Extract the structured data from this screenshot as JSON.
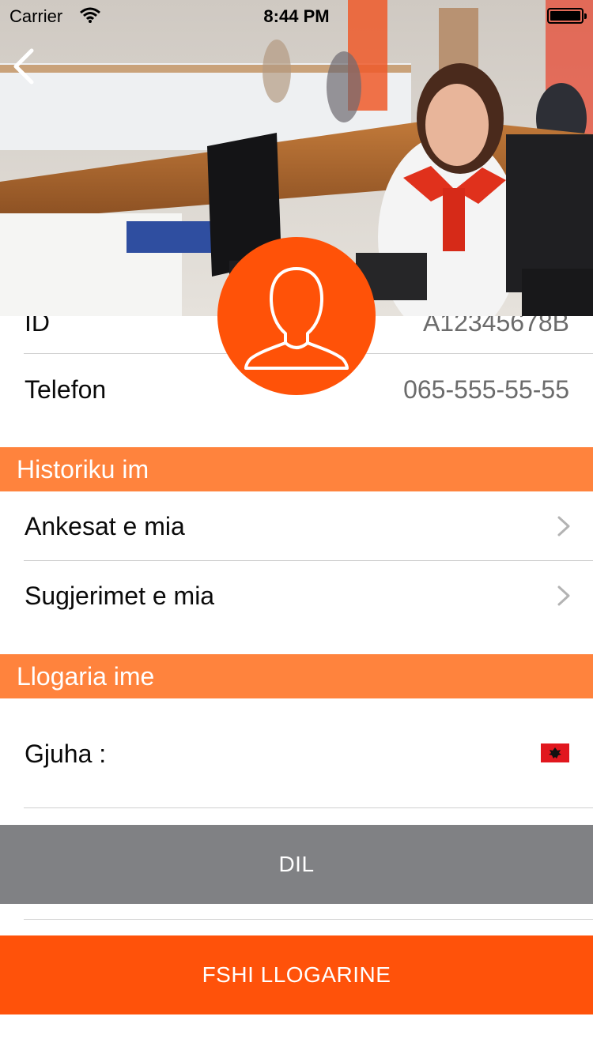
{
  "status_bar": {
    "carrier": "Carrier",
    "time": "8:44 PM"
  },
  "profile": {
    "rows": [
      {
        "label": "ID",
        "value": "A12345678B"
      },
      {
        "label": "Telefon",
        "value": "065-555-55-55"
      }
    ]
  },
  "history": {
    "title": "Historiku im",
    "items": [
      {
        "label": "Ankesat e mia"
      },
      {
        "label": "Sugjerimet e mia"
      }
    ]
  },
  "account": {
    "title": "Llogaria ime",
    "language_label": "Gjuha :",
    "language_flag": "albania-flag-icon"
  },
  "buttons": {
    "logout": "DIL",
    "delete_account": "FSHI LLOGARINE"
  },
  "colors": {
    "accent_orange": "#ff5208",
    "section_orange": "#ff833d",
    "logout_gray": "#808184"
  },
  "icons": {
    "back": "chevron-left-icon",
    "avatar": "user-silhouette-icon",
    "row_disclosure": "chevron-right-icon"
  }
}
